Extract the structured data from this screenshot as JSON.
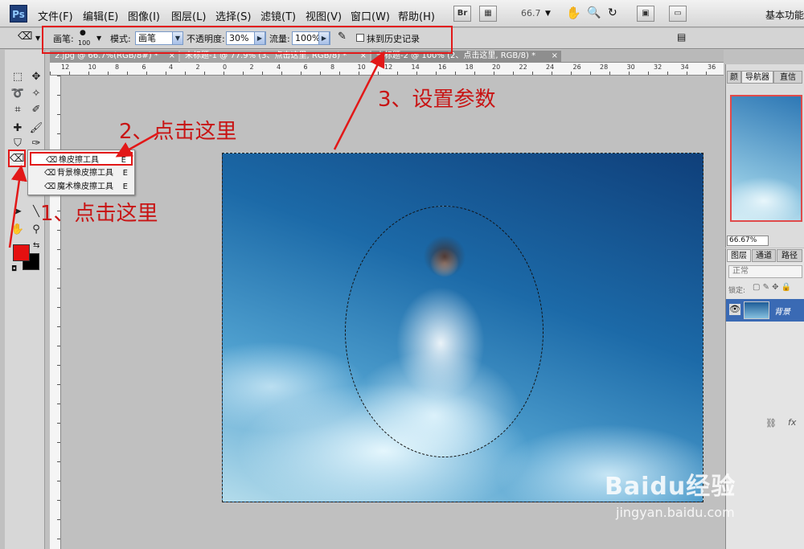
{
  "app": {
    "logo": "Ps",
    "workspace_label": "基本功能"
  },
  "menu": [
    "文件(F)",
    "编辑(E)",
    "图像(I)",
    "图层(L)",
    "选择(S)",
    "滤镜(T)",
    "视图(V)",
    "窗口(W)",
    "帮助(H)"
  ],
  "app_bar": {
    "bridge": "Br",
    "zoom": "66.7"
  },
  "options": {
    "brush_label": "画笔:",
    "brush_size": "100",
    "mode_label": "模式:",
    "mode_value": "画笔",
    "opacity_label": "不透明度:",
    "opacity_value": "30%",
    "flow_label": "流量:",
    "flow_value": "100%",
    "history_label": "抹到历史记录"
  },
  "tabs": [
    "2.jpg @ 66.7%(RGB/8#) *",
    "未标题-1 @ 77.9% (3、点击这里, RGB/8) *",
    "未标题-2 @ 100% (2、点击这里, RGB/8) *"
  ],
  "ruler_h": [
    "12",
    "10",
    "8",
    "6",
    "4",
    "2",
    "0",
    "2",
    "4",
    "6",
    "8",
    "10",
    "12",
    "14",
    "16",
    "18",
    "20",
    "22",
    "24",
    "26",
    "28",
    "30",
    "32",
    "34",
    "36"
  ],
  "flyout": {
    "items": [
      {
        "label": "橡皮擦工具",
        "shortcut": "E",
        "icon": "eraser-icon"
      },
      {
        "label": "背景橡皮擦工具",
        "shortcut": "E",
        "icon": "background-eraser-icon"
      },
      {
        "label": "魔术橡皮擦工具",
        "shortcut": "E",
        "icon": "magic-eraser-icon"
      }
    ]
  },
  "navigator": {
    "tabs": [
      "颜",
      "导航器",
      "直信"
    ],
    "zoom": "66.67%"
  },
  "layers": {
    "tabs": [
      "图层",
      "通道",
      "路径"
    ],
    "blend_mode": "正常",
    "lock_label": "锁定:",
    "layer_name": "背景"
  },
  "annotations": {
    "step1": "1、点击这里",
    "step2": "2、点击这里",
    "step3": "3、设置参数"
  },
  "watermark": {
    "brand": "Baidu经验",
    "url": "jingyan.baidu.com"
  },
  "colors": {
    "foreground": "#e51010",
    "background": "#000000",
    "annotation": "#e21818"
  }
}
